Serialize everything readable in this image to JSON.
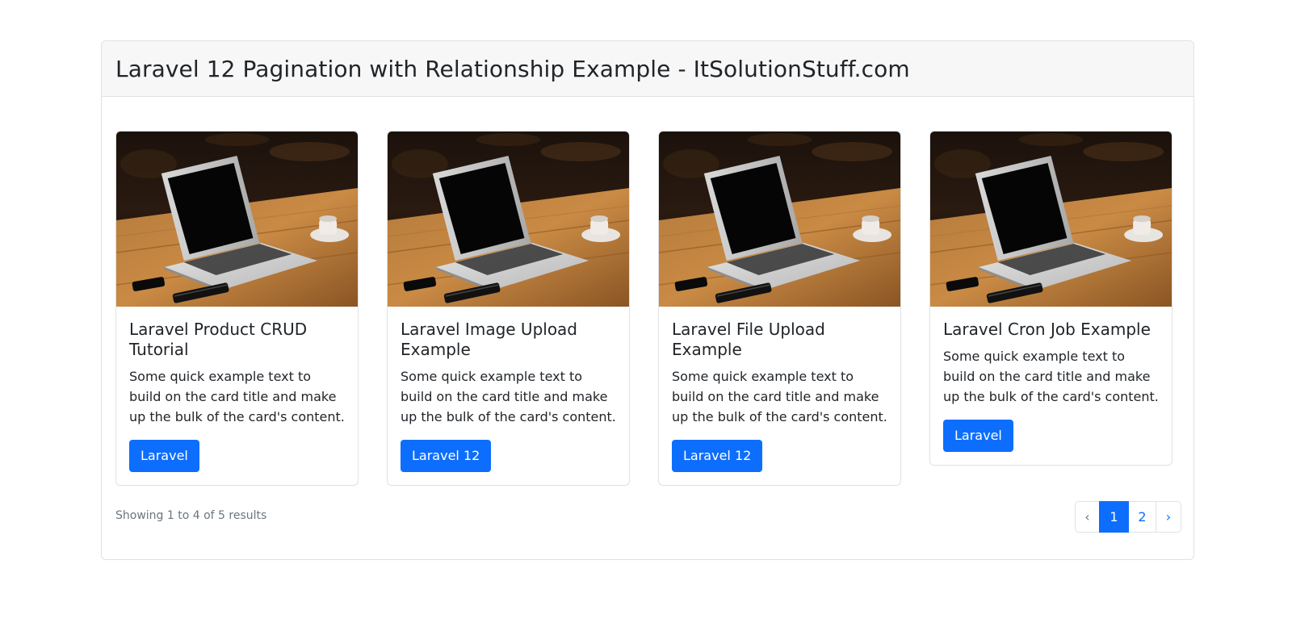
{
  "header": {
    "title": "Laravel 12 Pagination with Relationship Example - ItSolutionStuff.com"
  },
  "cards": [
    {
      "title": "Laravel Product CRUD Tutorial",
      "text": "Some quick example text to build on the card title and make up the bulk of the card's content.",
      "button": "Laravel"
    },
    {
      "title": "Laravel Image Upload Example",
      "text": "Some quick example text to build on the card title and make up the bulk of the card's content.",
      "button": "Laravel 12"
    },
    {
      "title": "Laravel File Upload Example",
      "text": "Some quick example text to build on the card title and make up the bulk of the card's content.",
      "button": "Laravel 12"
    },
    {
      "title": "Laravel Cron Job Example",
      "text": "Some quick example text to build on the card title and make up the bulk of the card's content.",
      "button": "Laravel"
    }
  ],
  "footer": {
    "showing": "Showing 1 to 4 of 5 results"
  },
  "pagination": {
    "prev": "‹",
    "pages": [
      "1",
      "2"
    ],
    "active_page": "1",
    "next": "›"
  },
  "colors": {
    "primary": "#0d6efd",
    "muted": "#6c757d",
    "header_bg": "#f7f7f7"
  },
  "icons": {
    "card_image": "laptop-on-desk-photo"
  }
}
